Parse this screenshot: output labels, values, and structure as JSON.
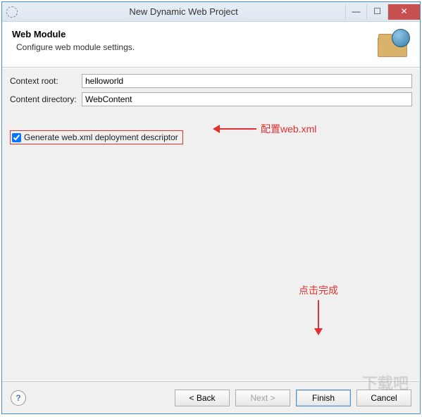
{
  "window": {
    "title": "New Dynamic Web Project"
  },
  "header": {
    "title": "Web Module",
    "subtitle": "Configure web module settings."
  },
  "form": {
    "context_root_label": "Context root:",
    "context_root_value": "helloworld",
    "content_dir_label": "Content directory:",
    "content_dir_value": "WebContent",
    "generate_xml_label": "Generate web.xml deployment descriptor"
  },
  "annotations": {
    "config_web": "配置web.xml",
    "click_finish": "点击完成"
  },
  "buttons": {
    "help": "?",
    "back": "< Back",
    "next": "Next >",
    "finish": "Finish",
    "cancel": "Cancel"
  },
  "watermark": "下载吧"
}
